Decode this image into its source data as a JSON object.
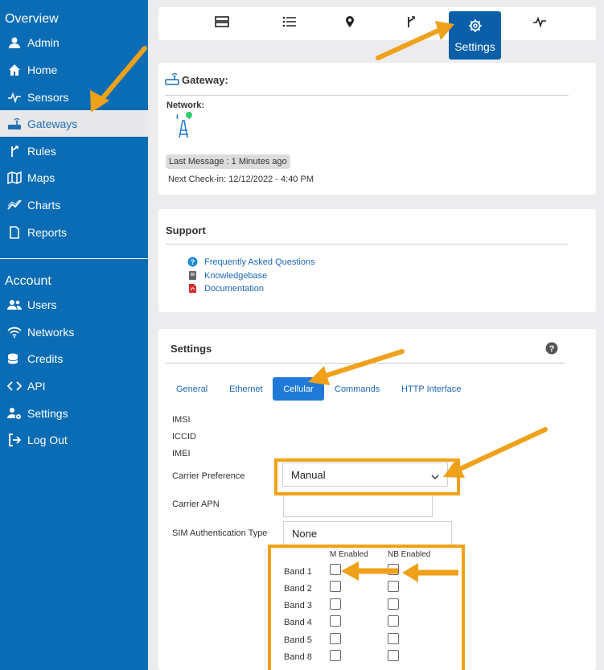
{
  "sidebar": {
    "overview_heading": "Overview",
    "account_heading": "Account",
    "overview_items": [
      {
        "label": "Admin",
        "icon": "user-icon"
      },
      {
        "label": "Home",
        "icon": "home-icon"
      },
      {
        "label": "Sensors",
        "icon": "pulse-icon"
      },
      {
        "label": "Gateways",
        "icon": "router-icon",
        "active": true
      },
      {
        "label": "Rules",
        "icon": "fork-icon"
      },
      {
        "label": "Maps",
        "icon": "map-icon"
      },
      {
        "label": "Charts",
        "icon": "chart-line-icon"
      },
      {
        "label": "Reports",
        "icon": "document-icon"
      }
    ],
    "account_items": [
      {
        "label": "Users",
        "icon": "users-icon"
      },
      {
        "label": "Networks",
        "icon": "wifi-icon"
      },
      {
        "label": "Credits",
        "icon": "coins-icon"
      },
      {
        "label": "API",
        "icon": "code-icon"
      },
      {
        "label": "Settings",
        "icon": "user-gear-icon"
      },
      {
        "label": "Log Out",
        "icon": "logout-icon"
      }
    ]
  },
  "toolbar": {
    "settings_label": "Settings"
  },
  "gateway": {
    "title": "Gateway:",
    "network_label": "Network:",
    "last_message": "Last Message : 1 Minutes ago",
    "next_checkin": "Next Check-in: 12/12/2022 - 4:40 PM"
  },
  "support": {
    "title": "Support",
    "links": [
      "Frequently Asked Questions",
      "Knowledgebase",
      "Documentation"
    ]
  },
  "settings": {
    "title": "Settings",
    "tabs": [
      "General",
      "Ethernet",
      "Cellular",
      "Commands",
      "HTTP Interface"
    ],
    "imsi_label": "IMSI",
    "iccid_label": "ICCID",
    "imei_label": "IMEI",
    "carrier_pref_label": "Carrier Preference",
    "carrier_pref_value": "Manual",
    "carrier_apn_label": "Carrier APN",
    "carrier_apn_value": "",
    "sim_auth_label": "SIM Authentication Type",
    "sim_auth_value": "None",
    "band_headers": [
      "M Enabled",
      "NB Enabled"
    ],
    "bands": [
      "Band 1",
      "Band 2",
      "Band 3",
      "Band 4",
      "Band 5",
      "Band 8"
    ]
  },
  "colors": {
    "sidebar_bg": "#0a6cb4",
    "highlight": "#f0a11a",
    "active_tab": "#1f79d6",
    "status_dot": "#2ecc71"
  }
}
